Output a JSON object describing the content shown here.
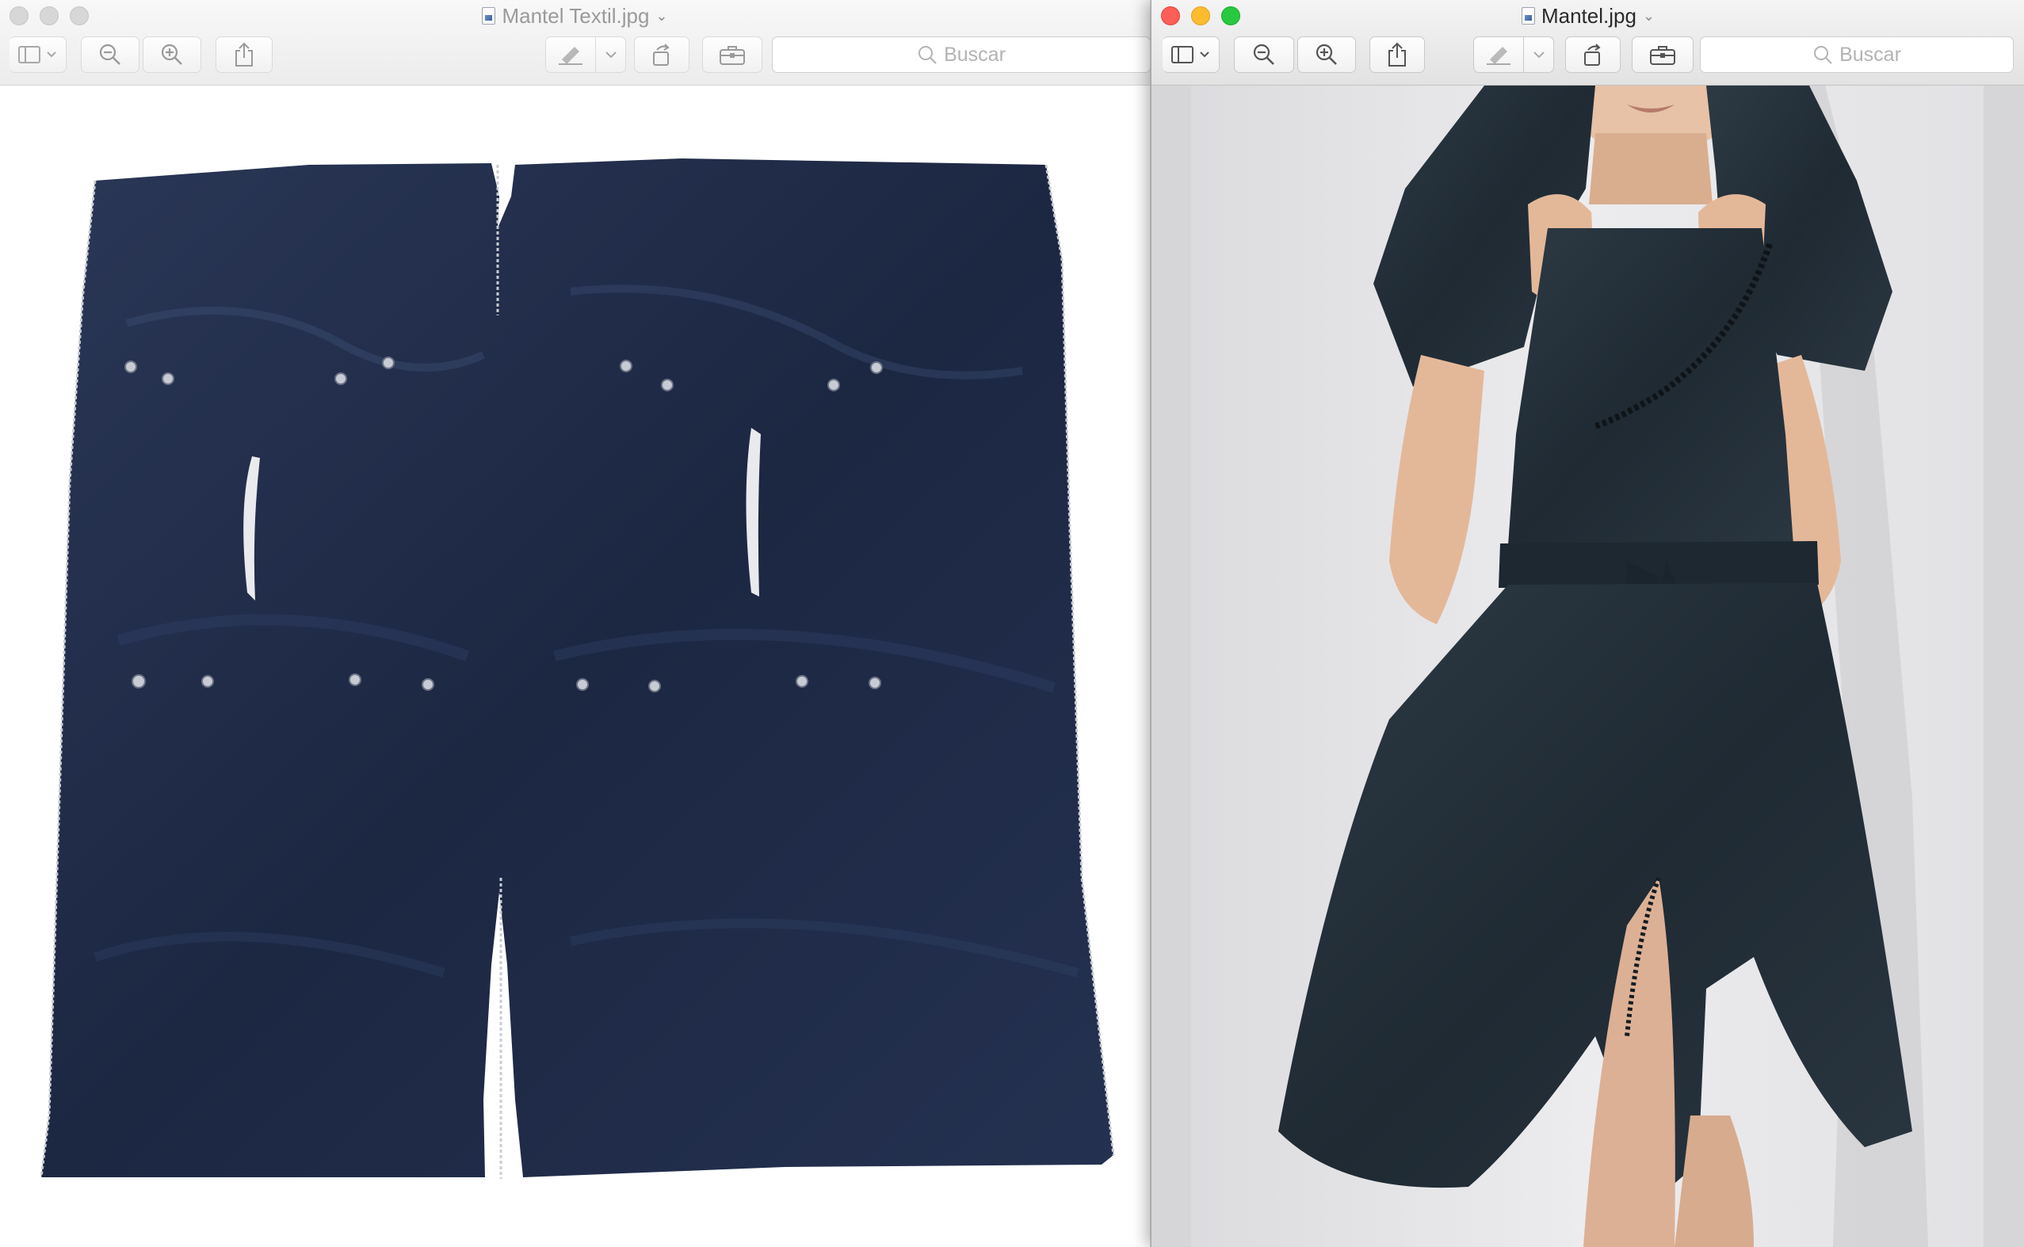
{
  "left_window": {
    "title": "Mantel Textil.jpg",
    "active": false,
    "toolbar": {
      "sidebar_icon": "sidebar-icon",
      "zoom_out_icon": "zoom-out-icon",
      "zoom_in_icon": "zoom-in-icon",
      "share_icon": "share-icon",
      "markup_icon": "markup-pen-icon",
      "rotate_icon": "rotate-icon",
      "toolbox_icon": "toolbox-icon"
    },
    "search": {
      "placeholder": "Buscar"
    },
    "image": {
      "subject": "flat-laid navy garment"
    }
  },
  "right_window": {
    "title": "Mantel.jpg",
    "active": true,
    "search": {
      "placeholder": "Buscar"
    },
    "image": {
      "subject": "person wearing dark dress"
    }
  },
  "colors": {
    "close": "#fc5f57",
    "minimize": "#fdbc2e",
    "maximize": "#28c840",
    "garment_navy": "#1f2b45",
    "dress_dark": "#243039",
    "background_right": "#e9e9eb"
  }
}
